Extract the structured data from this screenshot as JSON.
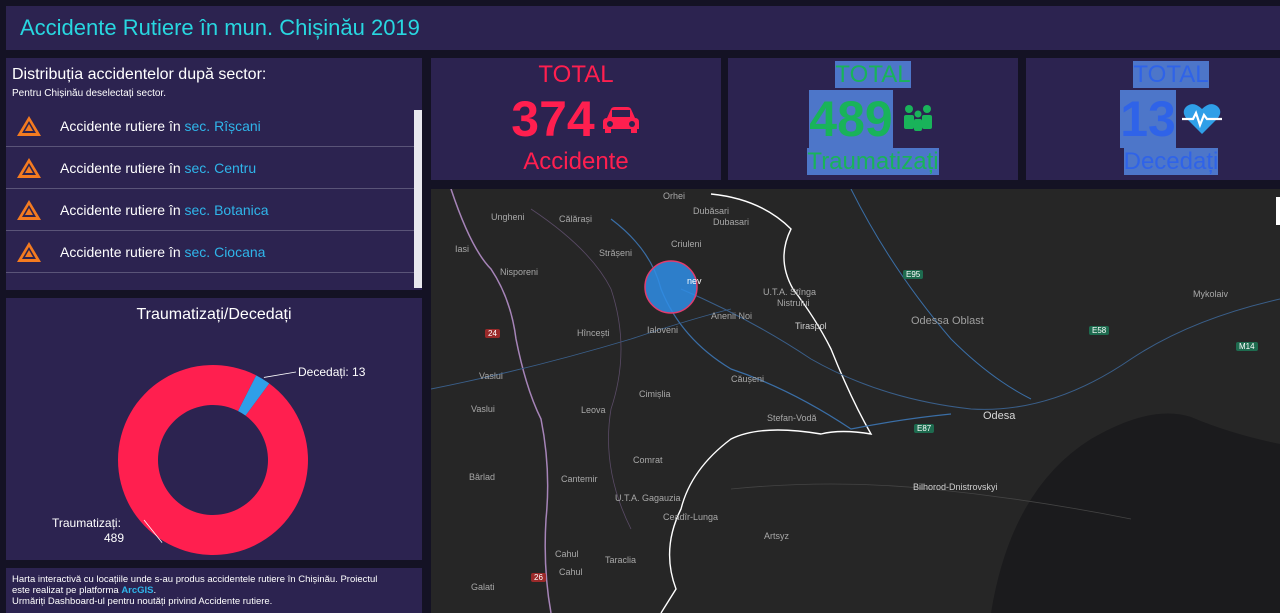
{
  "header": {
    "title": "Accidente Rutiere în mun. Chișinău 2019"
  },
  "sector_list": {
    "title": "Distribuția accidentelor după sector:",
    "subtitle": "Pentru Chișinău deselectați sector.",
    "items": [
      {
        "prefix": "Accidente rutiere în",
        "sector": "sec. Rîșcani"
      },
      {
        "prefix": "Accidente rutiere în",
        "sector": "sec. Centru"
      },
      {
        "prefix": "Accidente rutiere în",
        "sector": "sec. Botanica"
      },
      {
        "prefix": "Accidente rutiere în",
        "sector": "sec. Ciocana"
      }
    ]
  },
  "tiles": [
    {
      "label": "TOTAL",
      "value": "374",
      "bottom": "Accidente",
      "color": "#ff1f4f",
      "icon": "car-icon"
    },
    {
      "label": "TOTAL",
      "value": "489",
      "bottom": "Traumatizați",
      "color": "#19b35a",
      "icon": "people-icon"
    },
    {
      "label": "TOTAL",
      "value": "13",
      "bottom": "Decedați",
      "color": "#2f63e8",
      "icon": "heart-pulse-icon"
    }
  ],
  "chart_data": {
    "type": "pie",
    "title": "Traumatizați/Decedați",
    "donut": true,
    "slices": [
      {
        "name": "Traumatizați",
        "value": 489,
        "color": "#ff1f4f"
      },
      {
        "name": "Decedați",
        "value": 13,
        "color": "#2f9fe8"
      }
    ],
    "labels": {
      "deaths": "Decedați: 13",
      "injured_name": "Traumatizați:",
      "injured_value": "489"
    }
  },
  "footer": {
    "line1": "Harta interactivă cu locațiile unde s-au produs accidentele rutiere în Chișinău. Proiectul",
    "line2_prefix": "este realizat pe platforma",
    "line2_link": "ArcGIS",
    "line2_suffix": ".",
    "line3": "Urmăriți Dashboard-ul pentru noutăți privind Accidente rutiere."
  },
  "map": {
    "labels": [
      "Orhei",
      "Dubăsari",
      "Dubasari",
      "Ungheni",
      "Călărași",
      "Criuleni",
      "Iasi",
      "Strășeni",
      "Nisporeni",
      "nev",
      "U.T.A. Stînga",
      "Nistrului",
      "Hîncești",
      "Ialoveni",
      "Anenii Noi",
      "Tiraspol",
      "Odessa Oblast",
      "Mykolaiv",
      "Vaslui",
      "Căușeni",
      "Vaslui",
      "Leova",
      "Cimișlia",
      "Stefan-Vodă",
      "Odesa",
      "Comrat",
      "Bârlad",
      "Cantemir",
      "U.T.A. Gagauzia",
      "Bilhorod-Dnistrovskyi",
      "Ceadîr-Lunga",
      "Artsyz",
      "Cahul",
      "Cahul",
      "Taraclia",
      "Galati"
    ],
    "shields": [
      "E95",
      "E58",
      "M14",
      "24",
      "E87",
      "26"
    ]
  }
}
